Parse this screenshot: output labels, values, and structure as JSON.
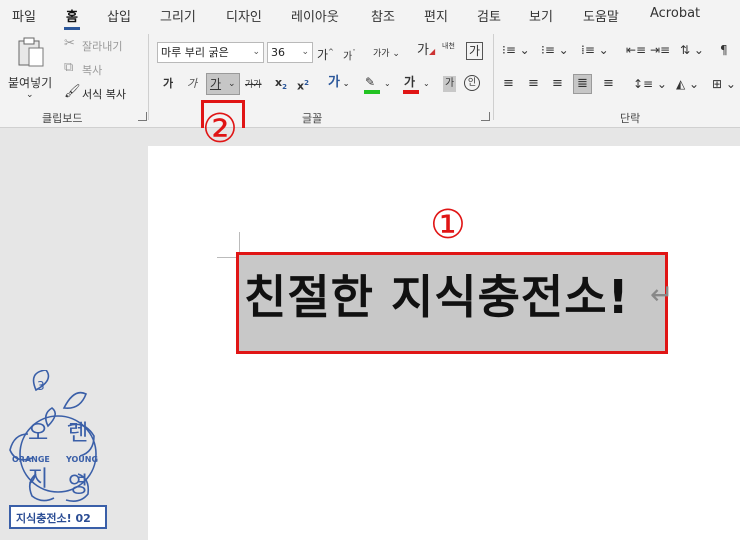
{
  "tabs": [
    "파일",
    "홈",
    "삽입",
    "그리기",
    "디자인",
    "레이아웃",
    "참조",
    "편지",
    "검토",
    "보기",
    "도움말",
    "Acrobat"
  ],
  "clipboard": {
    "paste": "붙여넣기",
    "cut": "잘라내기",
    "copy": "복사",
    "format_painter": "서식 복사",
    "label": "클립보드"
  },
  "font": {
    "font_name": "마루 부리 굵은",
    "font_size": "36",
    "grow": "가",
    "shrink": "가",
    "case": "가가",
    "clear": "가",
    "phonetic": "내천",
    "border": "가",
    "bold": "가",
    "italic": "가",
    "underline": "가",
    "strike": "가가",
    "sub": "x",
    "sub_mark": "2",
    "sup": "x",
    "sup_mark": "2",
    "effect": "가",
    "font_color": "가",
    "shading": "가",
    "enclose": "인",
    "label": "글꼴"
  },
  "paragraph": {
    "label": "단락"
  },
  "document": {
    "heading": "친절한 지식충전소!",
    "para_mark": "↵"
  },
  "callouts": {
    "one": "①",
    "two": "②"
  },
  "logo": {
    "number": "3",
    "line1_left": "오",
    "line1_right": "렌",
    "orange": "ORANGE",
    "young": "YOUNG",
    "line2_left": "지",
    "line2_right": "영",
    "footer": "지식충전소! 02"
  },
  "colors": {
    "accent": "#2b579a",
    "highlight_red": "#e01515",
    "logo_blue": "#3a5fa8",
    "highlight_green": "#22c322",
    "font_red": "#e01515"
  }
}
